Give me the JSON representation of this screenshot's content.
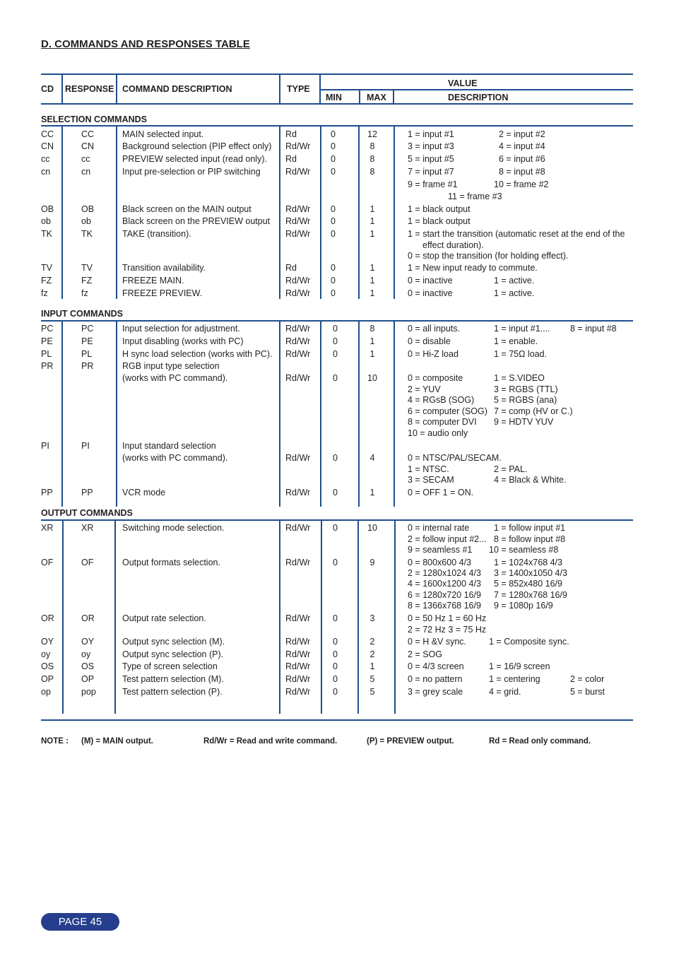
{
  "title": "D. COMMANDS AND RESPONSES TABLE",
  "header": {
    "cd": "CD",
    "response": "RESPONSE",
    "command_description": "COMMAND DESCRIPTION",
    "type": "TYPE",
    "value": "VALUE",
    "min": "MIN",
    "max": "MAX",
    "description": "DESCRIPTION"
  },
  "sections": {
    "selection": {
      "label": "SELECTION COMMANDS",
      "rows": [
        {
          "cd": "CC",
          "resp": "CC",
          "cmd": "MAIN selected input.",
          "type": "Rd",
          "min": "0",
          "max": "12",
          "desc": [
            [
              "1 = input #1",
              "2 = input #2"
            ]
          ]
        },
        {
          "cd": "CN",
          "resp": "CN",
          "cmd": "Background selection (PIP effect only)",
          "type": "Rd/Wr",
          "min": "0",
          "max": "8",
          "desc": [
            [
              "3 = input #3",
              "4 = input #4"
            ]
          ]
        },
        {
          "cd": "cc",
          "resp": "cc",
          "cmd": "PREVIEW selected input (read only).",
          "type": "Rd",
          "min": "0",
          "max": "8",
          "desc": [
            [
              "5 = input #5",
              "6 = input #6"
            ]
          ]
        },
        {
          "cd": "cn",
          "resp": "cn",
          "cmd": "Input pre-selection or PIP switching",
          "type": "Rd/Wr",
          "min": "0",
          "max": "8",
          "desc": [
            [
              "7 = input #7",
              "8 = input #8"
            ],
            [
              "9 = frame #1",
              "10 = frame #2"
            ],
            [
              "11 = frame #3"
            ]
          ]
        },
        {
          "cd": "OB",
          "resp": "OB",
          "cmd": "Black screen on the MAIN output",
          "type": "Rd/Wr",
          "min": "0",
          "max": "1",
          "desc": [
            [
              "1 = black output"
            ]
          ]
        },
        {
          "cd": "ob",
          "resp": "ob",
          "cmd": "Black screen on  the PREVIEW output",
          "type": "Rd/Wr",
          "min": "0",
          "max": "1",
          "desc": [
            [
              "1 = black output"
            ]
          ]
        },
        {
          "cd": "TK",
          "resp": "TK",
          "cmd": "TAKE (transition).",
          "type": "Rd/Wr",
          "min": "0",
          "max": "1",
          "desc": [
            [
              "1 = start the transition (automatic reset at the end of the"
            ],
            [
              "effect duration)."
            ],
            [
              "0 = stop the transition (for holding effect)."
            ]
          ]
        },
        {
          "cd": "TV",
          "resp": "TV",
          "cmd": "Transition availability.",
          "type": "Rd",
          "min": "0",
          "max": "1",
          "desc": [
            [
              "1 = New input ready to commute."
            ]
          ]
        },
        {
          "cd": "FZ",
          "resp": "FZ",
          "cmd": "FREEZE MAIN.",
          "type": "Rd/Wr",
          "min": "0",
          "max": "1",
          "desc": [
            [
              "0 = inactive",
              "1 = active."
            ]
          ]
        },
        {
          "cd": "fz",
          "resp": "fz",
          "cmd": "FREEZE PREVIEW.",
          "type": "Rd/Wr",
          "min": "0",
          "max": "1",
          "desc": [
            [
              "0 = inactive",
              "1 = active."
            ]
          ]
        }
      ]
    },
    "input": {
      "label": "INPUT COMMANDS",
      "rows": [
        {
          "cd": "PC",
          "resp": "PC",
          "cmd": "Input selection for adjustment.",
          "type": "Rd/Wr",
          "min": "0",
          "max": "8",
          "desc": [
            [
              "0 = all inputs.",
              "1 = input #1....",
              "8 = input #8"
            ]
          ]
        },
        {
          "cd": "PE",
          "resp": "PE",
          "cmd": "Input disabling (works with PC)",
          "type": "Rd/Wr",
          "min": "0",
          "max": "1",
          "desc": [
            [
              "0 = disable",
              "1 = enable."
            ]
          ]
        },
        {
          "cd": "PL",
          "resp": "PL",
          "cmd": "H sync load selection (works with PC).",
          "type": "Rd/Wr",
          "min": "0",
          "max": "1",
          "desc": [
            [
              "0 = Hi-Z load",
              "1 = 75Ω load."
            ]
          ]
        },
        {
          "cd": "PR",
          "resp": "PR",
          "cmd": "RGB input type selection",
          "cmd2": "(works with PC command).",
          "type": "Rd/Wr",
          "min": "0",
          "max": "10",
          "desc": [
            [
              "0 = composite",
              "1 = S.VIDEO"
            ],
            [
              "2 = YUV",
              "3 = RGBS (TTL)"
            ],
            [
              "4 = RGsB (SOG)",
              "5 = RGBS (ana)"
            ],
            [
              "6 = computer (SOG)",
              "7 = comp (HV or C.)"
            ],
            [
              "8 = computer DVI",
              "9 = HDTV YUV"
            ],
            [
              "10 = audio only"
            ]
          ]
        },
        {
          "cd": "PI",
          "resp": "PI",
          "cmd": "Input standard selection",
          "cmd2": "(works with PC command).",
          "type": "Rd/Wr",
          "min": "0",
          "max": "4",
          "desc": [
            [
              "0 = NTSC/PAL/SECAM."
            ],
            [
              "1 = NTSC.",
              "2 = PAL."
            ],
            [
              "3 = SECAM",
              "4 = Black & White."
            ]
          ]
        },
        {
          "cd": "PP",
          "resp": "PP",
          "cmd": "VCR mode",
          "type": "Rd/Wr",
          "min": "0",
          "max": "1",
          "desc": [
            [
              "0 = OFF   1 = ON."
            ]
          ]
        }
      ]
    },
    "output": {
      "label": "OUTPUT COMMANDS",
      "rows": [
        {
          "cd": "XR",
          "resp": "XR",
          "cmd": "Switching mode selection.",
          "type": "Rd/Wr",
          "min": "0",
          "max": "10",
          "desc": [
            [
              "0 = internal rate",
              "1 = follow input #1"
            ],
            [
              "2 = follow input #2...",
              "8 = follow input #8"
            ],
            [
              "9 = seamless #1",
              "10 = seamless #8"
            ]
          ]
        },
        {
          "cd": "OF",
          "resp": "OF",
          "cmd": "Output formats selection.",
          "type": "Rd/Wr",
          "min": "0",
          "max": "9",
          "desc": [
            [
              "0 = 800x600     4/3",
              "1 = 1024x768   4/3"
            ],
            [
              "2 = 1280x1024 4/3",
              "3 = 1400x1050 4/3"
            ],
            [
              "4 = 1600x1200 4/3",
              "5 = 852x480   16/9"
            ],
            [
              "6 = 1280x720 16/9",
              "7 = 1280x768 16/9"
            ],
            [
              "8 = 1366x768 16/9",
              "9 = 1080p       16/9"
            ]
          ]
        },
        {
          "cd": "OR",
          "resp": "OR",
          "cmd": "Output rate selection.",
          "type": "Rd/Wr",
          "min": "0",
          "max": "3",
          "desc": [
            [
              "0 = 50 Hz 1 = 60 Hz"
            ],
            [
              "2 = 72 Hz 3 = 75 Hz"
            ]
          ]
        },
        {
          "cd": "OY",
          "resp": "OY",
          "cmd": "Output sync selection (M).",
          "type": "Rd/Wr",
          "min": "0",
          "max": "2",
          "desc": [
            [
              "0 = H &V sync.",
              "1 = Composite sync."
            ]
          ]
        },
        {
          "cd": "oy",
          "resp": "oy",
          "cmd": "Output sync selection (P).",
          "type": "Rd/Wr",
          "min": "0",
          "max": "2",
          "desc": [
            [
              "2 = SOG"
            ]
          ]
        },
        {
          "cd": "OS",
          "resp": "OS",
          "cmd": "Type of screen selection",
          "type": "Rd/Wr",
          "min": "0",
          "max": "1",
          "desc": [
            [
              "0 = 4/3 screen",
              "1 = 16/9 screen"
            ]
          ]
        },
        {
          "cd": "OP",
          "resp": "OP",
          "cmd": "Test pattern selection (M).",
          "type": "Rd/Wr",
          "min": "0",
          "max": "5",
          "desc": [
            [
              "0 = no pattern",
              "1 = centering",
              "2 = color"
            ]
          ]
        },
        {
          "cd": "op",
          "resp": "pop",
          "cmd": "Test pattern selection (P).",
          "type": "Rd/Wr",
          "min": "0",
          "max": "5",
          "desc": [
            [
              "3 = grey scale",
              "4 = grid.",
              "5 = burst"
            ]
          ]
        }
      ]
    }
  },
  "note": {
    "label": "NOTE :",
    "items": [
      "(M) = MAIN output.",
      "Rd/Wr = Read and write command.",
      "(P) = PREVIEW output.",
      "Rd = Read only command."
    ]
  },
  "page": "PAGE 45",
  "colors": {
    "rule": "#1f4e8c",
    "badge": "#263e8e"
  }
}
